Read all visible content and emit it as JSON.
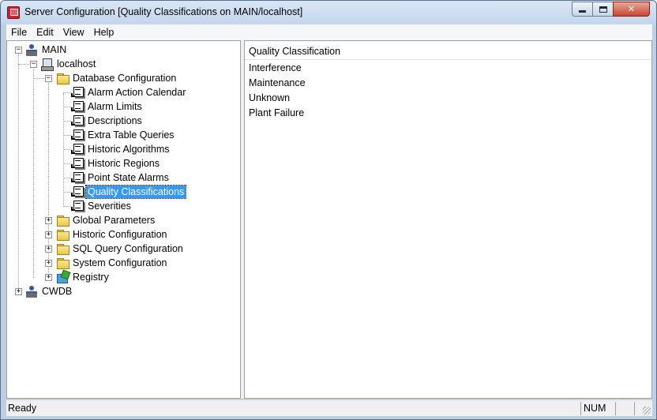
{
  "window": {
    "title": "Server Configuration [Quality Classifications on MAIN/localhost]",
    "minimize_icon": "minimize-icon",
    "maximize_icon": "maximize-icon",
    "close_glyph": "✕"
  },
  "menu": {
    "items": [
      "File",
      "Edit",
      "View",
      "Help"
    ]
  },
  "tree": {
    "main": "MAIN",
    "localhost": "localhost",
    "database_configuration": "Database Configuration",
    "db_children": [
      "Alarm Action Calendar",
      "Alarm Limits",
      "Descriptions",
      "Extra Table Queries",
      "Historic Algorithms",
      "Historic Regions",
      "Point State Alarms",
      "Quality Classifications",
      "Severities"
    ],
    "selected": "Quality Classifications",
    "global_parameters": "Global Parameters",
    "historic_configuration": "Historic Configuration",
    "sql_query_configuration": "SQL Query Configuration",
    "system_configuration": "System Configuration",
    "registry": "Registry",
    "cwdb": "CWDB",
    "expand_glyph": "+",
    "collapse_glyph": "−"
  },
  "list": {
    "header": "Quality Classification",
    "rows": [
      "Interference",
      "Maintenance",
      "Unknown",
      "Plant Failure"
    ]
  },
  "status": {
    "text": "Ready",
    "num": "NUM"
  },
  "colors": {
    "selection": "#3399ff",
    "close_button": "#c7452e"
  }
}
